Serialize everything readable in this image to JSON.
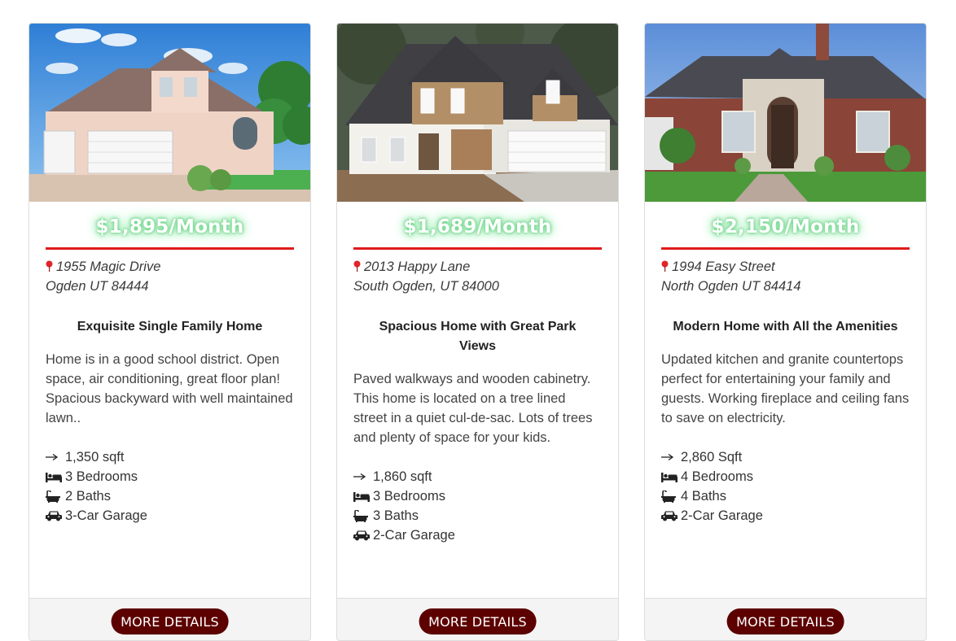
{
  "listings": [
    {
      "price": "$1,895/Month",
      "address_line1": "1955 Magic Drive",
      "address_line2": "Ogden UT 84444",
      "title": "Exquisite Single Family Home",
      "description": "Home is in a good school district. Open space, air conditioning, great floor plan! Spacious backyward with well maintained lawn..",
      "sqft": "1,350 sqft",
      "bedrooms": "3 Bedrooms",
      "baths": "2 Baths",
      "garage": "3-Car Garage",
      "button": "MORE DETAILS"
    },
    {
      "price": "$1,689/Month",
      "address_line1": "2013 Happy Lane",
      "address_line2": "South Ogden, UT 84000",
      "title": "Spacious Home with Great Park Views",
      "description": "Paved walkways and wooden cabinetry. This home is located on a tree lined street in a quiet cul-de-sac. Lots of trees and plenty of space for your kids.",
      "sqft": "1,860 sqft",
      "bedrooms": "3 Bedrooms",
      "baths": "3 Baths",
      "garage": "2-Car Garage",
      "button": "MORE DETAILS"
    },
    {
      "price": "$2,150/Month",
      "address_line1": "1994 Easy Street",
      "address_line2": "North Ogden UT 84414",
      "title": "Modern Home with All the Amenities",
      "description": "Updated kitchen and granite countertops perfect for entertaining your family and guests. Working fireplace and ceiling fans to save on electricity.",
      "sqft": "2,860 Sqft",
      "bedrooms": "4 Bedrooms",
      "baths": "4 Baths",
      "garage": "2-Car Garage",
      "button": "MORE DETAILS"
    }
  ],
  "icons": {
    "sqft": "arrow-right-icon",
    "bedrooms": "bed-icon",
    "baths": "bath-icon",
    "garage": "car-icon",
    "address": "map-pin-icon"
  },
  "colors": {
    "price_glow": "#7fe09a",
    "divider": "#e11b1b",
    "button_bg": "#5c0000",
    "pin": "#e0242a"
  }
}
